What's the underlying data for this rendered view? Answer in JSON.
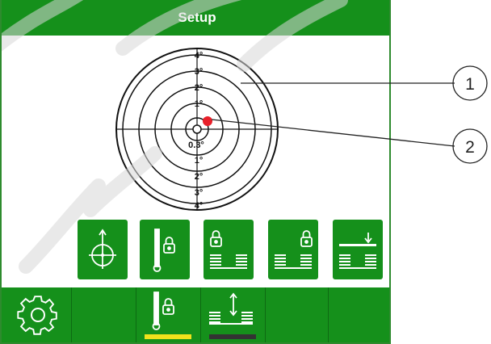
{
  "title": "Setup",
  "level_display": {
    "ring_labels_top": [
      "4°",
      "3°",
      "2°",
      "1°"
    ],
    "center_label": "0.3°",
    "ring_labels_bottom": [
      "1°",
      "2°",
      "3°",
      "4°"
    ],
    "indicator_color": "#e8202a"
  },
  "callouts": [
    "1",
    "2"
  ],
  "function_buttons": [
    {
      "icon": "crosshair-arrow-icon"
    },
    {
      "icon": "boom-lock-icon"
    },
    {
      "icon": "left-outrigger-lock-icon"
    },
    {
      "icon": "right-outrigger-lock-icon"
    },
    {
      "icon": "lower-platform-icon"
    }
  ],
  "bottom_bar": [
    {
      "icon": "gear-icon"
    },
    {
      "icon": ""
    },
    {
      "icon": "boom-lock-icon",
      "indicator_color": "#f0e21c"
    },
    {
      "icon": "raise-lower-icon",
      "indicator_color": "#333333"
    },
    {
      "icon": ""
    },
    {
      "icon": ""
    }
  ],
  "colors": {
    "accent": "#15901b",
    "indicator_active": "#f0e21c"
  }
}
